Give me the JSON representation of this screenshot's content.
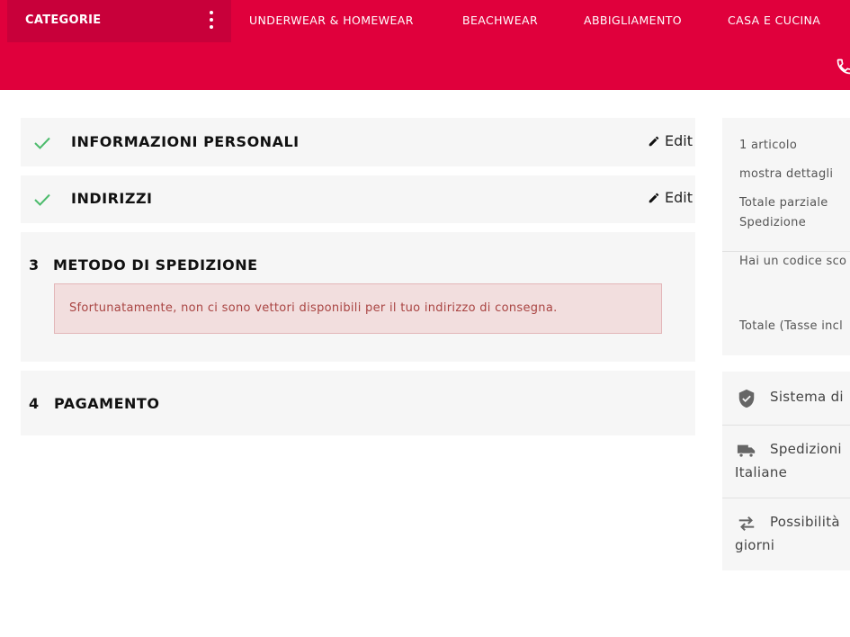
{
  "header": {
    "categories_label": "CATEGORIE",
    "nav": [
      "UNDERWEAR & HOMEWEAR",
      "BEACHWEAR",
      "ABBIGLIAMENTO",
      "CASA E CUCINA"
    ],
    "brand_color": "#e0003c"
  },
  "steps": {
    "personal": {
      "title": "INFORMAZIONI PERSONALI",
      "edit": "Edit"
    },
    "address": {
      "title": "INDIRIZZI",
      "edit": "Edit"
    },
    "shipping": {
      "number": "3",
      "title": "METODO DI SPEDIZIONE",
      "alert": "Sfortunatamente, non ci sono vettori disponibili per il tuo indirizzo di consegna."
    },
    "payment": {
      "number": "4",
      "title": "PAGAMENTO"
    }
  },
  "summary": {
    "items_count": "1 articolo",
    "show_details": "mostra dettagli",
    "subtotal": "Totale parziale",
    "shipping": "Spedizione",
    "discount_prompt": "Hai un codice sco",
    "total": "Totale (Tasse incl"
  },
  "reassurance": [
    {
      "icon": "shield-check-icon",
      "line1": "Sistema di",
      "line2": ""
    },
    {
      "icon": "truck-icon",
      "line1": "Spedizioni",
      "line2": "Italiane"
    },
    {
      "icon": "arrows-exchange-icon",
      "line1": "Possibilità",
      "line2": "giorni"
    }
  ],
  "colors": {
    "accent": "#e0003c",
    "check": "#4cbb6c",
    "alert_bg": "#f2dede",
    "alert_text": "#a94442"
  }
}
